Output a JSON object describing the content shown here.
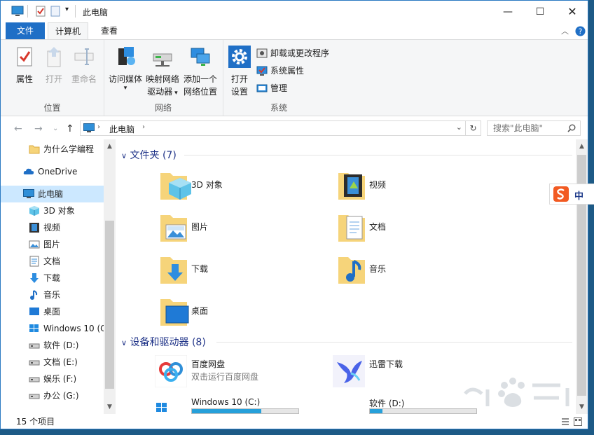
{
  "window": {
    "title": "此电脑"
  },
  "tabs": [
    {
      "label": "文件"
    },
    {
      "label": "计算机"
    },
    {
      "label": "查看"
    }
  ],
  "ribbon": {
    "location": {
      "label": "位置",
      "properties": "属性",
      "open": "打开",
      "rename": "重命名"
    },
    "network": {
      "label": "网络",
      "access_media_1": "访问媒体",
      "map_drive_1": "映射网络",
      "map_drive_2": "驱动器",
      "add_location_1": "添加一个",
      "add_location_2": "网络位置"
    },
    "system": {
      "label": "系统",
      "open_settings_1": "打开",
      "open_settings_2": "设置",
      "uninstall": "卸载或更改程序",
      "sys_props": "系统属性",
      "manage": "管理"
    }
  },
  "address": {
    "path": "此电脑",
    "search_placeholder": "搜索\"此电脑\""
  },
  "nav": {
    "items": [
      {
        "label": "为什么学编程",
        "icon": "folder-icon"
      },
      {
        "label": "OneDrive",
        "icon": "cloud-icon"
      },
      {
        "label": "此电脑",
        "icon": "computer-icon"
      },
      {
        "label": "3D 对象",
        "icon": "cube-icon"
      },
      {
        "label": "视频",
        "icon": "film-icon"
      },
      {
        "label": "图片",
        "icon": "picture-icon"
      },
      {
        "label": "文档",
        "icon": "document-icon"
      },
      {
        "label": "下载",
        "icon": "download-icon"
      },
      {
        "label": "音乐",
        "icon": "music-icon"
      },
      {
        "label": "桌面",
        "icon": "desktop-icon"
      },
      {
        "label": "Windows 10 (C",
        "icon": "windows-drive-icon"
      },
      {
        "label": "软件 (D:)",
        "icon": "drive-icon"
      },
      {
        "label": "文档 (E:)",
        "icon": "drive-icon"
      },
      {
        "label": "娱乐 (F:)",
        "icon": "drive-icon"
      },
      {
        "label": "办公 (G:)",
        "icon": "drive-icon"
      }
    ]
  },
  "content": {
    "folders_header": "文件夹 (7)",
    "folders": [
      {
        "label": "3D 对象"
      },
      {
        "label": "视频"
      },
      {
        "label": "图片"
      },
      {
        "label": "文档"
      },
      {
        "label": "下载"
      },
      {
        "label": "音乐"
      },
      {
        "label": "桌面"
      }
    ],
    "devices_header": "设备和驱动器 (8)",
    "devices": [
      {
        "label": "百度网盘",
        "sub": "双击运行百度网盘"
      },
      {
        "label": "迅雷下载",
        "sub": ""
      }
    ],
    "drives": [
      {
        "label": "Windows 10 (C:)",
        "used": 0.65
      },
      {
        "label": "软件 (D:)",
        "used": 0.12
      }
    ]
  },
  "status": {
    "count": "15 个项目"
  },
  "ime": {
    "label": "中"
  },
  "colors": {
    "accent": "#1f6fc6",
    "selected": "#cce8ff",
    "progress": "#26a0da",
    "heading": "#1e3287"
  }
}
